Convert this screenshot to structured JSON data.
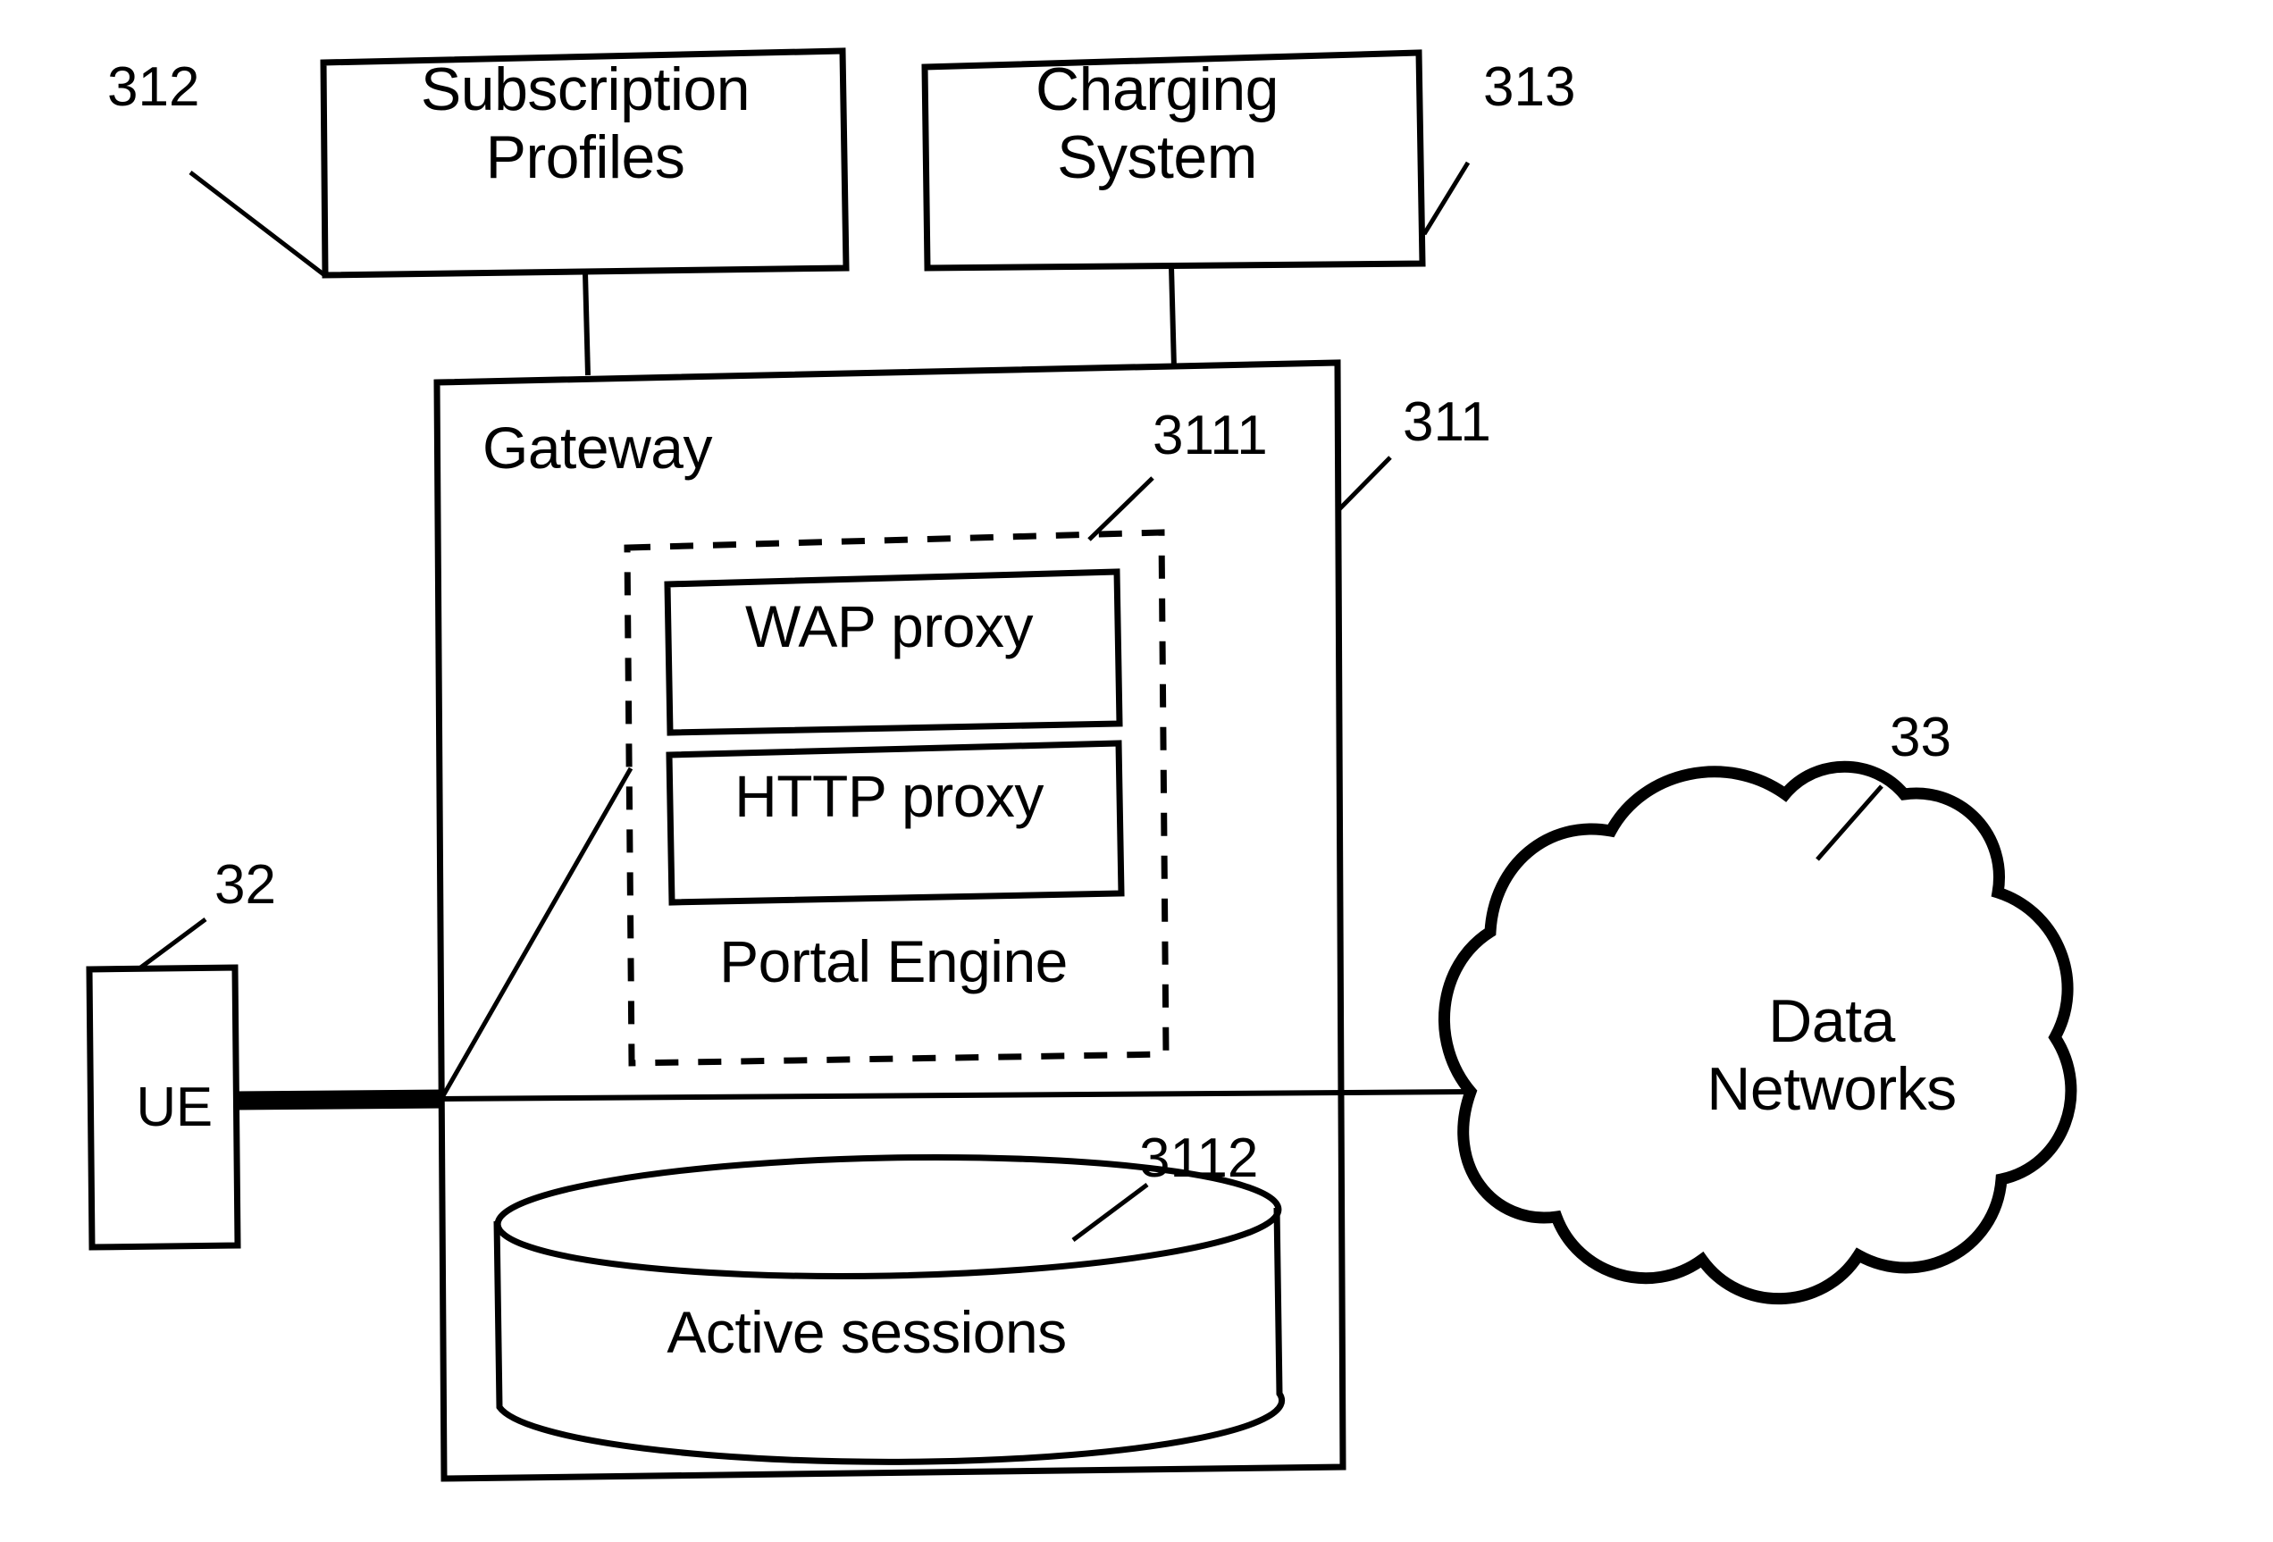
{
  "figure": {
    "type": "patent-block-diagram",
    "background_color": "#ffffff",
    "line_color": "#000000"
  },
  "nodes": {
    "subscription_profiles": {
      "label": "Subscription\nProfiles",
      "shape": "rectangle",
      "ref": "312"
    },
    "charging_system": {
      "label": "Charging\nSystem",
      "shape": "rectangle",
      "ref": "313"
    },
    "gateway": {
      "label": "Gateway",
      "shape": "rectangle",
      "ref": "311"
    },
    "portal_engine": {
      "label": "Portal Engine",
      "shape": "dashed-rectangle",
      "ref": "3111"
    },
    "wap_proxy": {
      "label": "WAP proxy",
      "shape": "rectangle"
    },
    "http_proxy": {
      "label": "HTTP proxy",
      "shape": "rectangle"
    },
    "active_sessions": {
      "label": "Active sessions",
      "shape": "cylinder",
      "ref": "3112"
    },
    "ue": {
      "label": "UE",
      "shape": "rectangle",
      "ref": "32"
    },
    "data_networks": {
      "label": "Data\nNetworks",
      "shape": "cloud",
      "ref": "33"
    }
  },
  "reference_numerals": {
    "r312": "312",
    "r313": "313",
    "r311": "311",
    "r3111": "3111",
    "r3112": "3112",
    "r32": "32",
    "r33": "33"
  },
  "connections": [
    {
      "name": "subscription-profiles-to-gateway",
      "style": "solid-thin"
    },
    {
      "name": "charging-system-to-gateway",
      "style": "solid-thin"
    },
    {
      "name": "ue-to-gateway",
      "style": "solid-thick"
    },
    {
      "name": "gateway-to-data-networks",
      "style": "solid-thin"
    }
  ]
}
